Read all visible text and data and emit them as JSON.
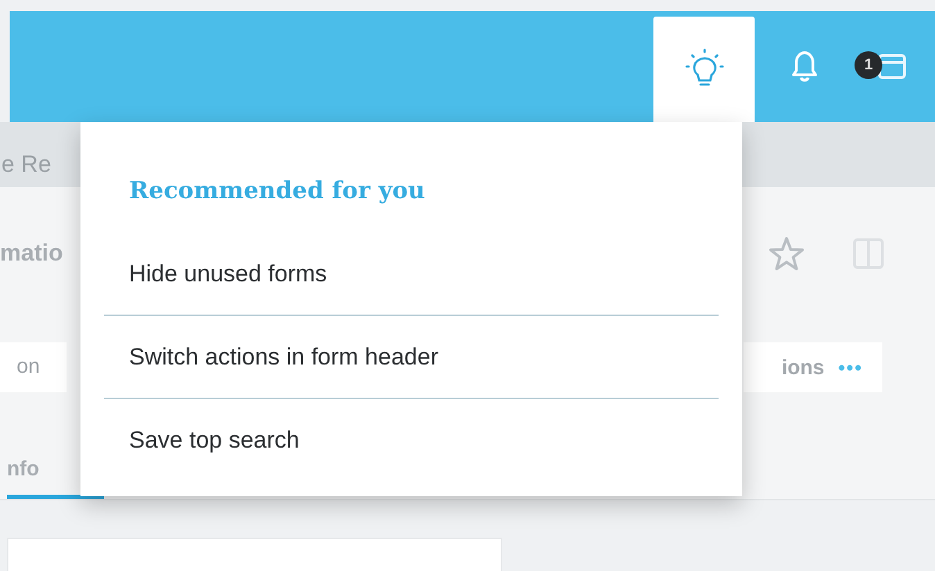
{
  "header": {
    "notification_badge": "1"
  },
  "background": {
    "breadcrumb": "e Re",
    "title": "matio",
    "field": "on",
    "actions": {
      "label": "ions",
      "more": "•••"
    },
    "tab": {
      "label": "nfo",
      "selected": true
    }
  },
  "popup": {
    "heading": "Recommended for you",
    "items": [
      {
        "label": "Hide unused forms"
      },
      {
        "label": "Switch actions in form header"
      },
      {
        "label": "Save top search"
      }
    ]
  }
}
